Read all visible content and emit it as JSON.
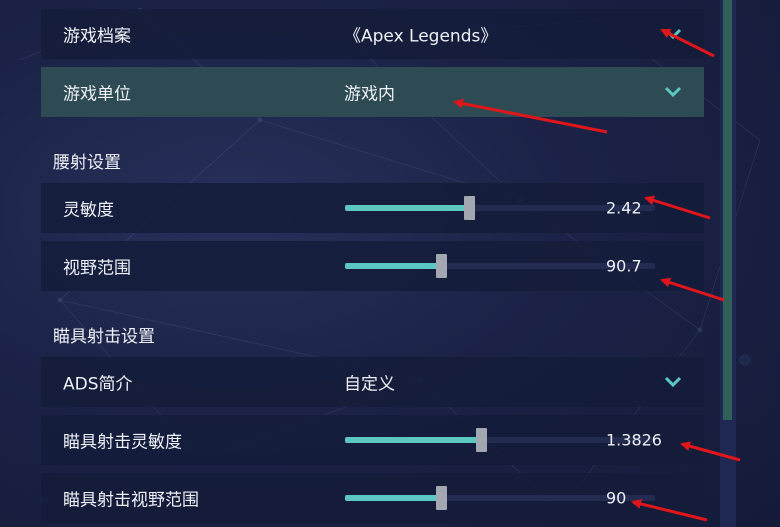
{
  "rows": {
    "game_profile": {
      "label": "游戏档案",
      "value": "《Apex Legends》"
    },
    "game_unit": {
      "label": "游戏单位",
      "value": "游戏内"
    },
    "hip_sens": {
      "label": "灵敏度",
      "value": "2.42",
      "slider_level": 0.4
    },
    "hip_fov": {
      "label": "视野范围",
      "value": "90.7",
      "slider_level": 0.31
    },
    "ads_profile": {
      "label": "ADS简介",
      "value": "自定义"
    },
    "ads_sens": {
      "label": "瞄具射击灵敏度",
      "value": "1.3826",
      "slider_level": 0.44
    },
    "ads_fov": {
      "label": "瞄具射击视野范围",
      "value": "90",
      "slider_level": 0.31
    }
  },
  "sections": {
    "hipfire": "腰射设置",
    "ads": "瞄具射击设置"
  },
  "colors": {
    "accent": "#5cc6c0",
    "active_row": "#2e4a52",
    "annotation_arrow": "#e0161b"
  },
  "icons": {
    "dropdown": "chevron-down-icon"
  }
}
